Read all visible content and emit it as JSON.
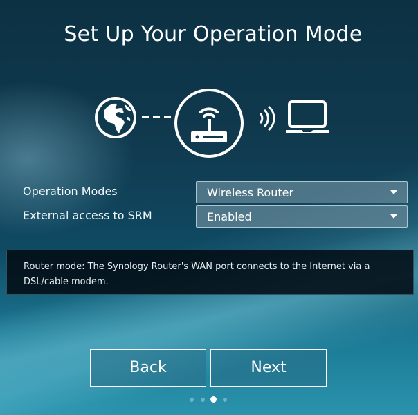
{
  "header": {
    "title": "Set Up Your Operation Mode"
  },
  "diagram": {
    "icons": [
      "globe-icon",
      "router-icon",
      "wireless-signal-icon",
      "laptop-icon"
    ]
  },
  "form": {
    "operation_modes": {
      "label": "Operation Modes",
      "value": "Wireless Router"
    },
    "external_access": {
      "label": "External access to SRM",
      "value": "Enabled"
    }
  },
  "info": {
    "text": "Router mode: The Synology Router's WAN port connects to the Internet via a DSL/cable modem."
  },
  "buttons": {
    "back_label": "Back",
    "next_label": "Next"
  },
  "pagination": {
    "total_steps": 4,
    "current_step": 3
  }
}
